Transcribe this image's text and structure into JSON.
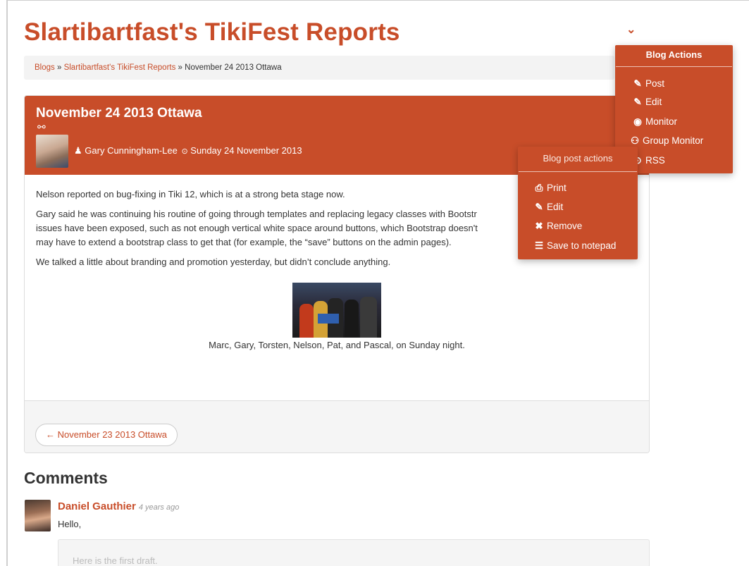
{
  "page": {
    "title": "Slartibartfast's TikiFest Reports",
    "chevron": "⌄"
  },
  "breadcrumb": {
    "blogs": "Blogs",
    "sep1": " » ",
    "blog": "Slartibartfast's TikiFest Reports",
    "sep2": " » ",
    "current": "November 24 2013 Ottawa"
  },
  "post": {
    "title": "November 24 2013 Ottawa",
    "author": "Gary Cunningham-Lee",
    "date": "Sunday 24 November 2013",
    "paragraphs": [
      "Nelson reported on bug-fixing in Tiki 12, which is at a strong beta stage now.",
      "Gary said he was continuing his routine of going through templates and replacing legacy classes with Bootstr",
      "issues have been exposed, such as not enough vertical white space around buttons, which Bootstrap doesn't",
      "may have to extend a bootstrap class to get that (for example, the “save” buttons on the admin pages).",
      "We talked a little about branding and promotion yesterday, but didn’t conclude anything."
    ],
    "caption": "Marc, Gary, Torsten, Nelson, Pat, and Pascal, on Sunday night.",
    "prev_link": "← November 23 2013 Ottawa"
  },
  "comments": {
    "heading": "Comments",
    "items": [
      {
        "author": "Daniel Gauthier",
        "time": "4 years ago",
        "text": "Hello,",
        "quote": "Here is the first draft."
      }
    ]
  },
  "blog_actions": {
    "title": "Blog Actions",
    "items": [
      {
        "label": "Post",
        "icon": "pencil-icon",
        "glyph": "✎"
      },
      {
        "label": "Edit",
        "icon": "edit-icon",
        "glyph": "✎"
      },
      {
        "label": "Monitor",
        "icon": "eye-icon",
        "glyph": "◉"
      },
      {
        "label": "Group Monitor",
        "icon": "group-icon",
        "glyph": "⚇"
      },
      {
        "label": "RSS",
        "icon": "rss-icon",
        "glyph": "⊙"
      }
    ]
  },
  "post_actions": {
    "title": "Blog post actions",
    "items": [
      {
        "label": "Print",
        "icon": "print-icon",
        "glyph": "⎙"
      },
      {
        "label": "Edit",
        "icon": "edit-icon",
        "glyph": "✎"
      },
      {
        "label": "Remove",
        "icon": "remove-icon",
        "glyph": "✖"
      },
      {
        "label": "Save to notepad",
        "icon": "notepad-icon",
        "glyph": "☰"
      }
    ]
  },
  "icons": {
    "link": "⚯",
    "user": "♟",
    "clock": "⊙"
  },
  "colors": {
    "accent": "#c84d29",
    "breadcrumb_bg": "#f3f3f3"
  }
}
